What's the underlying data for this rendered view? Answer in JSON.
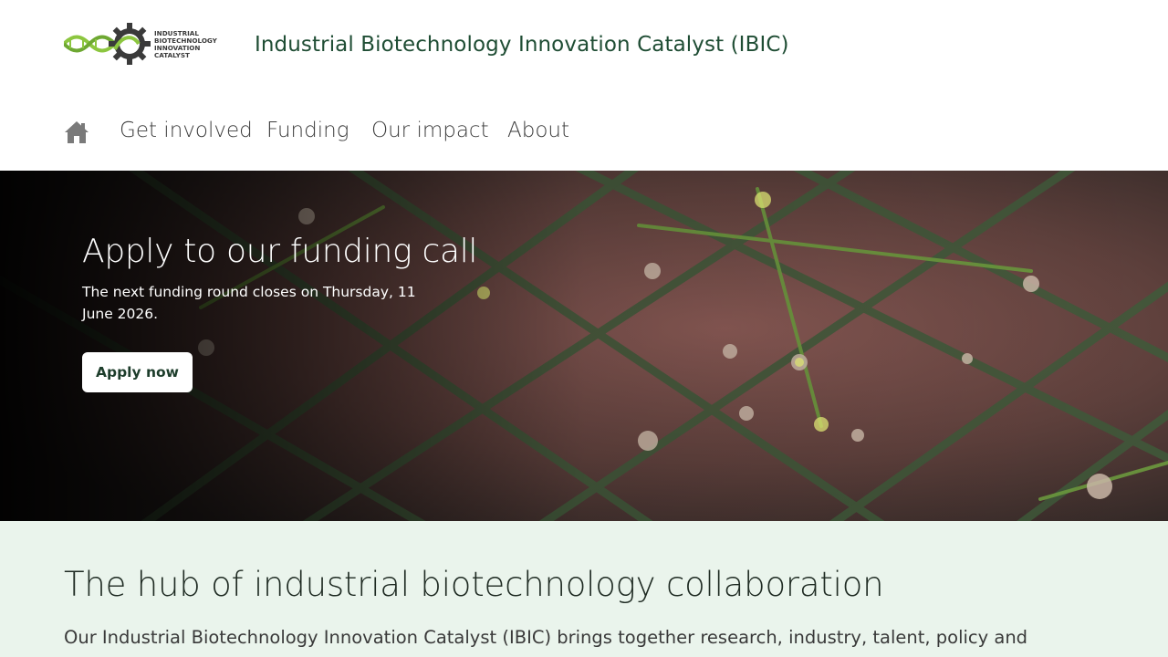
{
  "header": {
    "logo_text": [
      "INDUSTRIAL",
      "BIOTECHNOLOGY",
      "INNOVATION",
      "CATALYST"
    ],
    "site_title": "Industrial Biotechnology Innovation Catalyst (IBIC)"
  },
  "nav": {
    "home_icon": "home-icon",
    "items": [
      {
        "label": "Get involved"
      },
      {
        "label": "Funding"
      },
      {
        "label": "Our impact"
      },
      {
        "label": "About"
      }
    ]
  },
  "hero": {
    "title": "Apply to our funding call",
    "text": "The next funding round closes on Thursday, 11 June 2026.",
    "button_label": "Apply now"
  },
  "intro": {
    "heading": "The hub of industrial biotechnology collaboration",
    "text": "Our Industrial Biotechnology Innovation Catalyst (IBIC) brings together research, industry, talent, policy and funding to"
  },
  "colors": {
    "brand_green": "#1f4d34",
    "logo_green": "#8cc63f",
    "logo_gear": "#3a3a3a",
    "intro_bg": "#eaf4ec",
    "hero_bg": "#4a3534"
  }
}
